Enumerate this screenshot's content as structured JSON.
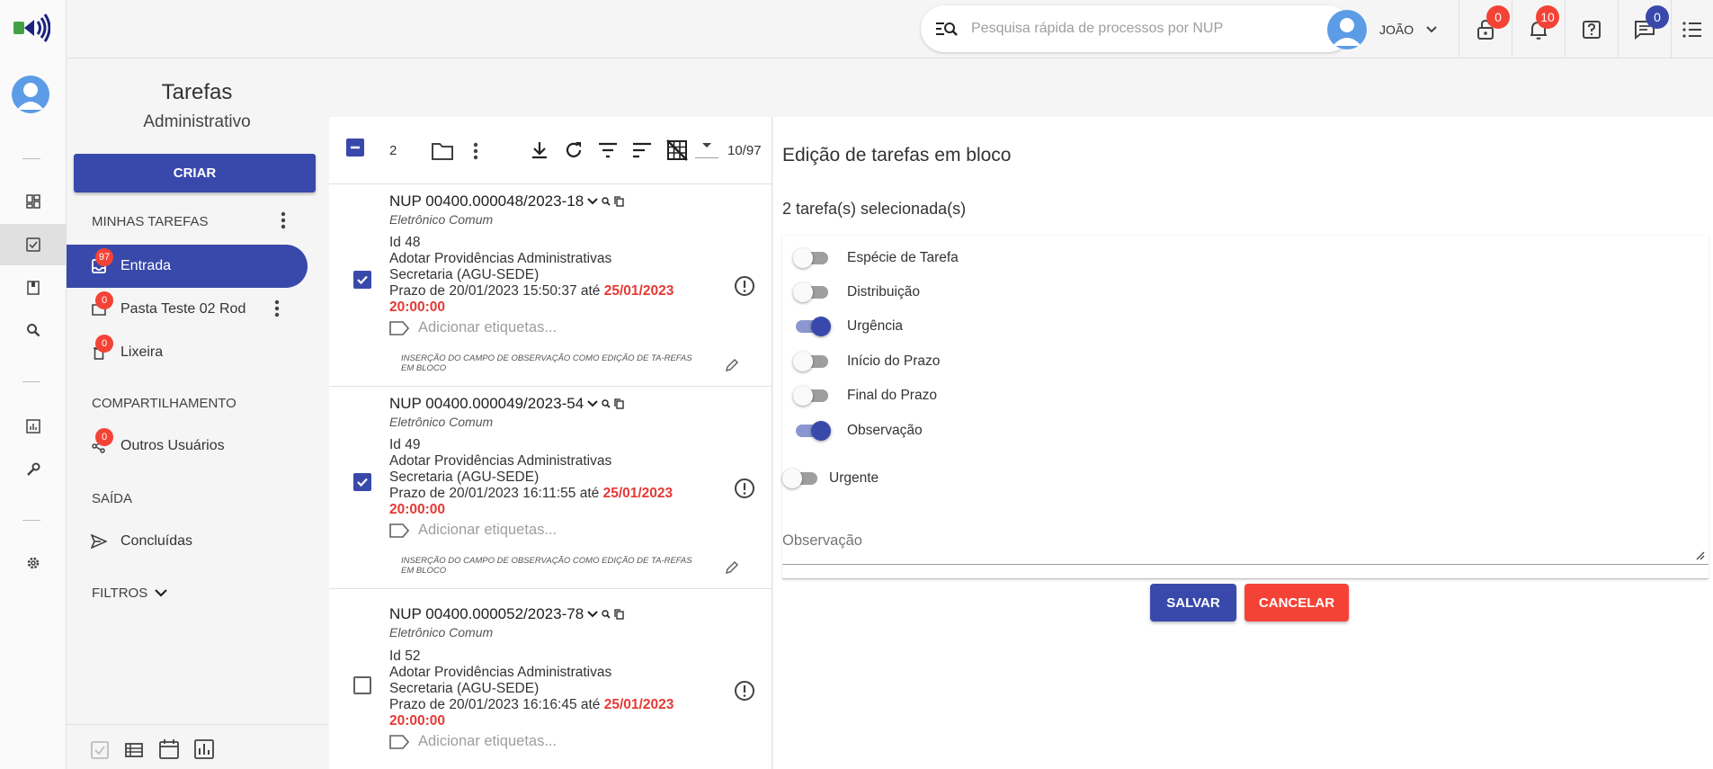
{
  "topbar": {
    "search_placeholder": "Pesquisa rápida de processos por NUP",
    "user_name": "JOÃO",
    "lock_badge": "0",
    "bell_badge": "10",
    "chat_badge": "0"
  },
  "left_panel": {
    "title": "Tarefas",
    "subtitle": "Administrativo",
    "create_label": "CRIAR",
    "my_tasks_header": "MINHAS TAREFAS",
    "items": [
      {
        "label": "Entrada",
        "badge": "97"
      },
      {
        "label": "Pasta Teste 02 Rod",
        "badge": "0"
      },
      {
        "label": "Lixeira",
        "badge": "0"
      }
    ],
    "sharing_header": "COMPARTILHAMENTO",
    "sharing_item": {
      "label": "Outros Usuários",
      "badge": "0"
    },
    "exit_header": "SAÍDA",
    "exit_item": {
      "label": "Concluídas"
    },
    "filters_label": "FILTROS"
  },
  "list": {
    "selected_count": "2",
    "pagination": "10/97",
    "tasks": [
      {
        "nup": "NUP 00400.000048/2023-18",
        "type": "Eletrônico Comum",
        "id": "Id 48",
        "desc": "Adotar Providências Administrativas",
        "unit": "Secretaria (AGU-SEDE)",
        "prazo": "Prazo de 20/01/2023 15:50:37 até",
        "ate_date": "25/01/2023",
        "ate_time": "20:00:00",
        "tags": "Adicionar etiquetas...",
        "obs": "INSERÇÃO DO CAMPO DE OBSERVAÇÃO COMO EDIÇÃO DE TA-REFAS EM BLOCO",
        "checked": true
      },
      {
        "nup": "NUP 00400.000049/2023-54",
        "type": "Eletrônico Comum",
        "id": "Id 49",
        "desc": "Adotar Providências Administrativas",
        "unit": "Secretaria (AGU-SEDE)",
        "prazo": "Prazo de 20/01/2023 16:11:55 até",
        "ate_date": "25/01/2023",
        "ate_time": "20:00:00",
        "tags": "Adicionar etiquetas...",
        "obs": "INSERÇÃO DO CAMPO DE OBSERVAÇÃO COMO EDIÇÃO DE TA-REFAS EM BLOCO",
        "checked": true
      },
      {
        "nup": "NUP 00400.000052/2023-78",
        "type": "Eletrônico Comum",
        "id": "Id 52",
        "desc": "Adotar Providências Administrativas",
        "unit": "Secretaria (AGU-SEDE)",
        "prazo": "Prazo de 20/01/2023 16:16:45 até",
        "ate_date": "25/01/2023",
        "ate_time": "20:00:00",
        "tags": "Adicionar etiquetas...",
        "checked": false
      }
    ]
  },
  "edit": {
    "title": "Edição de tarefas em bloco",
    "selected_text": "2 tarefa(s) selecionada(s)",
    "toggles": [
      {
        "label": "Espécie de Tarefa",
        "on": false
      },
      {
        "label": "Distribuição",
        "on": false
      },
      {
        "label": "Urgência",
        "on": true
      },
      {
        "label": "Início do Prazo",
        "on": false
      },
      {
        "label": "Final do Prazo",
        "on": false
      },
      {
        "label": "Observação",
        "on": true
      }
    ],
    "urgente_label": "Urgente",
    "urgente_on": false,
    "observacao_placeholder": "Observação",
    "save_label": "SALVAR",
    "cancel_label": "CANCELAR"
  },
  "colors": {
    "primary": "#3949ab",
    "danger": "#f44336",
    "deadline_red": "#e53935"
  }
}
